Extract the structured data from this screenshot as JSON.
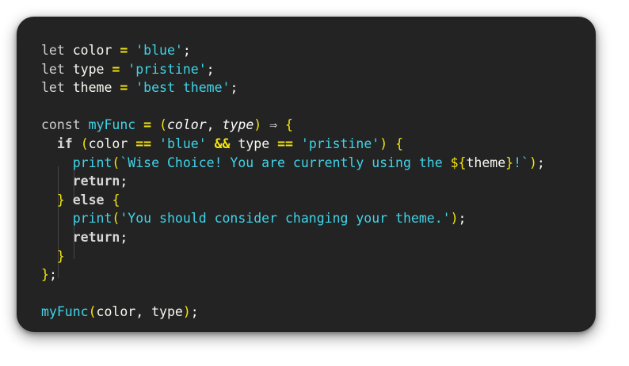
{
  "lines": [
    [
      {
        "t": "let",
        "c": "kw"
      },
      {
        "t": " color ",
        "c": "id"
      },
      {
        "t": "=",
        "c": "op"
      },
      {
        "t": " ",
        "c": "id"
      },
      {
        "t": "'blue'",
        "c": "str"
      },
      {
        "t": ";",
        "c": "pun"
      }
    ],
    [
      {
        "t": "let",
        "c": "kw"
      },
      {
        "t": " type ",
        "c": "id"
      },
      {
        "t": "=",
        "c": "op"
      },
      {
        "t": " ",
        "c": "id"
      },
      {
        "t": "'pristine'",
        "c": "str"
      },
      {
        "t": ";",
        "c": "pun"
      }
    ],
    [
      {
        "t": "let",
        "c": "kw"
      },
      {
        "t": " theme ",
        "c": "id"
      },
      {
        "t": "=",
        "c": "op"
      },
      {
        "t": " ",
        "c": "id"
      },
      {
        "t": "'best theme'",
        "c": "str"
      },
      {
        "t": ";",
        "c": "pun"
      }
    ],
    [],
    [
      {
        "t": "const",
        "c": "kw"
      },
      {
        "t": " ",
        "c": "id"
      },
      {
        "t": "myFunc",
        "c": "fn"
      },
      {
        "t": " ",
        "c": "id"
      },
      {
        "t": "=",
        "c": "op"
      },
      {
        "t": " ",
        "c": "id"
      },
      {
        "t": "(",
        "c": "br"
      },
      {
        "t": "color",
        "c": "par"
      },
      {
        "t": ", ",
        "c": "pun"
      },
      {
        "t": "type",
        "c": "par"
      },
      {
        "t": ")",
        "c": "br"
      },
      {
        "t": " ",
        "c": "id"
      },
      {
        "t": "⇒",
        "c": "kw"
      },
      {
        "t": " ",
        "c": "id"
      },
      {
        "t": "{",
        "c": "br"
      }
    ],
    [
      {
        "t": "  ",
        "c": "id"
      },
      {
        "t": "if",
        "c": "kwb"
      },
      {
        "t": " ",
        "c": "id"
      },
      {
        "t": "(",
        "c": "br"
      },
      {
        "t": "color ",
        "c": "id"
      },
      {
        "t": "==",
        "c": "op"
      },
      {
        "t": " ",
        "c": "id"
      },
      {
        "t": "'blue'",
        "c": "str"
      },
      {
        "t": " ",
        "c": "id"
      },
      {
        "t": "&&",
        "c": "op"
      },
      {
        "t": " type ",
        "c": "id"
      },
      {
        "t": "==",
        "c": "op"
      },
      {
        "t": " ",
        "c": "id"
      },
      {
        "t": "'pristine'",
        "c": "str"
      },
      {
        "t": ")",
        "c": "br"
      },
      {
        "t": " ",
        "c": "id"
      },
      {
        "t": "{",
        "c": "br"
      }
    ],
    [
      {
        "t": "    ",
        "c": "id"
      },
      {
        "t": "print",
        "c": "fn"
      },
      {
        "t": "(",
        "c": "br"
      },
      {
        "t": "`Wise Choice! You are currently using the ",
        "c": "str"
      },
      {
        "t": "${",
        "c": "br"
      },
      {
        "t": "theme",
        "c": "id"
      },
      {
        "t": "}",
        "c": "br"
      },
      {
        "t": "!`",
        "c": "str"
      },
      {
        "t": ")",
        "c": "br"
      },
      {
        "t": ";",
        "c": "pun"
      }
    ],
    [
      {
        "t": "    ",
        "c": "id"
      },
      {
        "t": "return",
        "c": "kwb"
      },
      {
        "t": ";",
        "c": "pun"
      }
    ],
    [
      {
        "t": "  ",
        "c": "id"
      },
      {
        "t": "}",
        "c": "br"
      },
      {
        "t": " ",
        "c": "id"
      },
      {
        "t": "else",
        "c": "kwb"
      },
      {
        "t": " ",
        "c": "id"
      },
      {
        "t": "{",
        "c": "br"
      }
    ],
    [
      {
        "t": "    ",
        "c": "id"
      },
      {
        "t": "print",
        "c": "fn"
      },
      {
        "t": "(",
        "c": "br"
      },
      {
        "t": "'You should consider changing your theme.'",
        "c": "str"
      },
      {
        "t": ")",
        "c": "br"
      },
      {
        "t": ";",
        "c": "pun"
      }
    ],
    [
      {
        "t": "    ",
        "c": "id"
      },
      {
        "t": "return",
        "c": "kwb"
      },
      {
        "t": ";",
        "c": "pun"
      }
    ],
    [
      {
        "t": "  ",
        "c": "id"
      },
      {
        "t": "}",
        "c": "br"
      }
    ],
    [
      {
        "t": "}",
        "c": "br"
      },
      {
        "t": ";",
        "c": "pun"
      }
    ],
    [],
    [
      {
        "t": "myFunc",
        "c": "fn"
      },
      {
        "t": "(",
        "c": "br"
      },
      {
        "t": "color, type",
        "c": "id"
      },
      {
        "t": ")",
        "c": "br"
      },
      {
        "t": ";",
        "c": "pun"
      }
    ]
  ],
  "colors": {
    "editor_background": "#232323",
    "string_and_function": "#3fd4e8",
    "operator_and_bracket": "#f2e40e",
    "keyword": "#d1d1d1",
    "identifier": "#f8f8f2",
    "indent_guide": "#464646"
  }
}
